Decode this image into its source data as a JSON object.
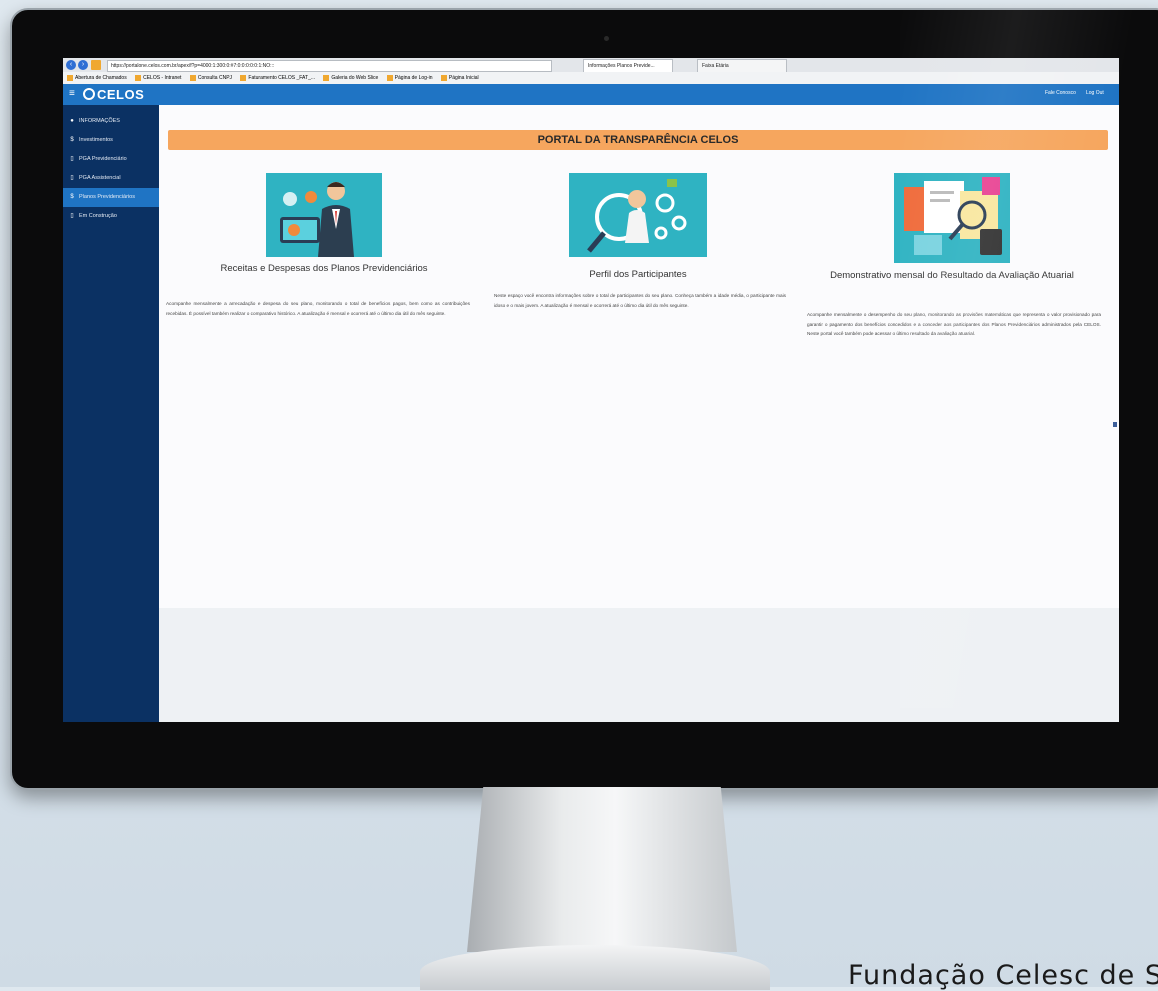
{
  "browser": {
    "url": "https://portalone.celos.com.br/apex/f?p=4000:1:300:0:#7:0:0:0:0:0:1:NO:::",
    "tabs": [
      "Informações Planos Previde...",
      "Faixa Etária"
    ],
    "favorites": [
      "Abertura de Chamados",
      "CELOS - Intranet",
      "Consulta CNPJ",
      "Faturamento CELOS _FAT_...",
      "Galeria do Web Slice",
      "Página de Log-in",
      "Página Inicial"
    ]
  },
  "header": {
    "logo": "CELOS",
    "links": [
      "Fale Conosco",
      "Log Out"
    ]
  },
  "sidebar": {
    "items": [
      {
        "icon": "●",
        "label": "INFORMAÇÕES"
      },
      {
        "icon": "$",
        "label": "Investimentos"
      },
      {
        "icon": "▯",
        "label": "PGA Previdenciário"
      },
      {
        "icon": "▯",
        "label": "PGA Assistencial"
      },
      {
        "icon": "$",
        "label": "Planos Previdenciários"
      },
      {
        "icon": "▯",
        "label": "Em Construção"
      }
    ]
  },
  "main": {
    "banner": "PORTAL DA TRANSPARÊNCIA CELOS",
    "cards": [
      {
        "title": "Receitas e Despesas dos Planos Previdenciários",
        "description": "Acompanhe mensalmente a arrecadação e despesa do seu plano, monitorando o total de benefícios pagos, bem como as contribuições recebidas. É possível também realizar o comparativo histórico. A atualização é mensal e ocorrerá até o último dia útil do mês seguinte."
      },
      {
        "title": "Perfil dos Participantes",
        "description": "Neste espaço você encontra informações sobre o total de participantes do seu plano. Conheça também a idade média, o participante mais idoso e o mais jovem. A atualização é mensal e ocorrerá até o último dia útil do mês seguinte."
      },
      {
        "title": "Demonstrativo mensal do Resultado da Avaliação Atuarial",
        "description": "Acompanhe mensalmente o desempenho do seu plano, monitorando as provisões matemáticas que representa o valor provisionado para garantir o pagamento dos benefícios concedidos e a conceder aos participantes dos Planos Previdenciários administrados pela CELOS. Neste portal você também pode acessar o último resultado da avaliação atuarial."
      }
    ]
  },
  "footer_text": "Fundação Celesc de S"
}
